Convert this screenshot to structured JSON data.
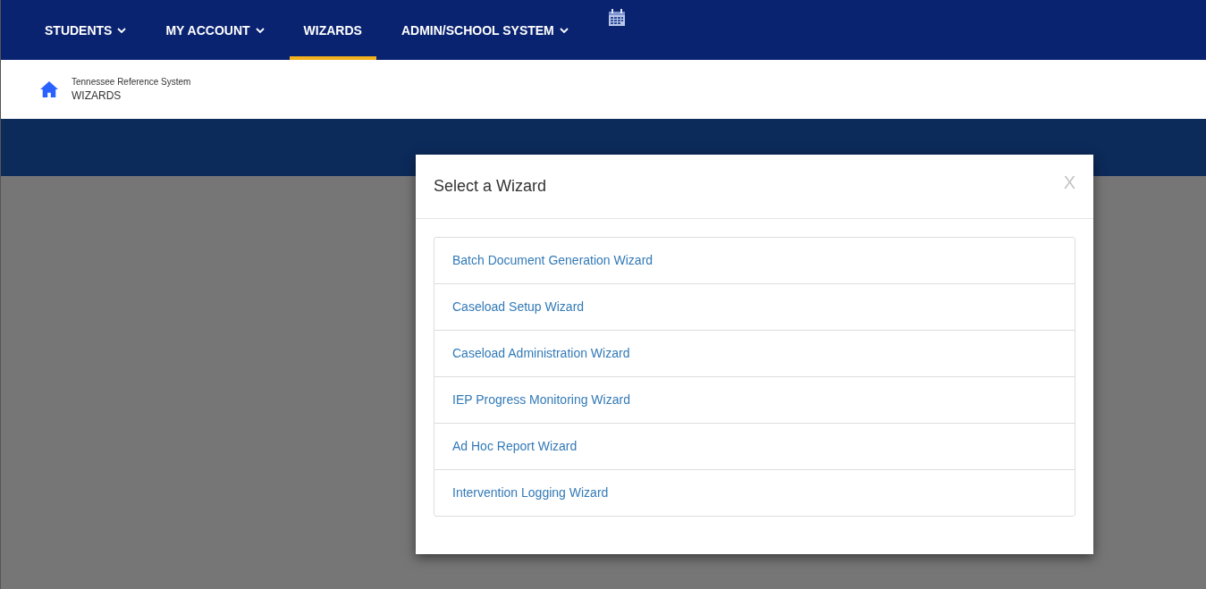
{
  "nav": {
    "items": [
      {
        "label": "STUDENTS",
        "dropdown": true,
        "selected": false
      },
      {
        "label": "MY ACCOUNT",
        "dropdown": true,
        "selected": false
      },
      {
        "label": "WIZARDS",
        "dropdown": false,
        "selected": true
      },
      {
        "label": "ADMIN/SCHOOL SYSTEM",
        "dropdown": true,
        "selected": false
      }
    ]
  },
  "breadcrumb": {
    "system": "Tennessee Reference System",
    "page": "WIZARDS"
  },
  "dialog": {
    "title": "Select a Wizard",
    "close": "X",
    "items": [
      "Batch Document Generation Wizard",
      "Caseload Setup Wizard",
      "Caseload Administration Wizard",
      "IEP Progress Monitoring Wizard",
      "Ad Hoc Report Wizard",
      "Intervention Logging Wizard"
    ]
  }
}
